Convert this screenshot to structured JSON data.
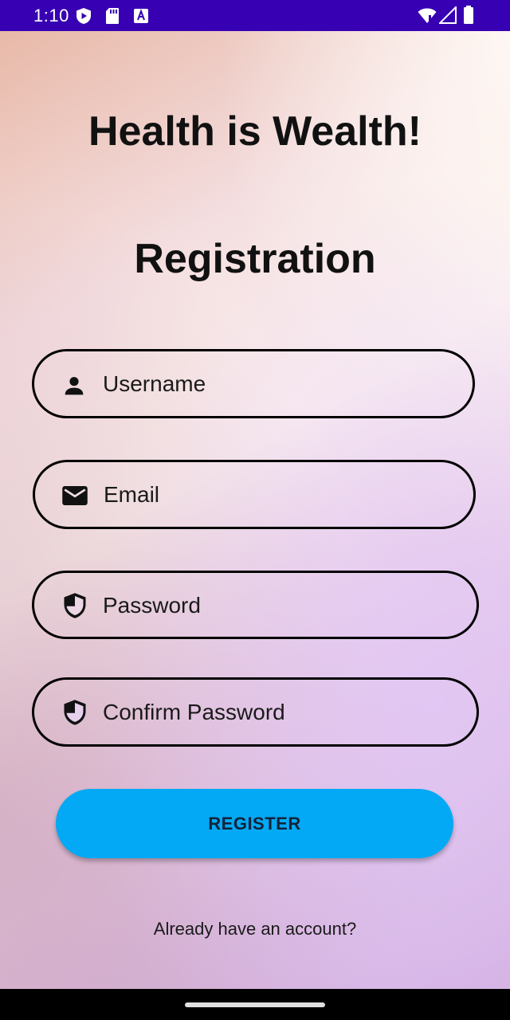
{
  "status_bar": {
    "time": "1:10"
  },
  "screen": {
    "tagline": "Health is Wealth!",
    "title": "Registration"
  },
  "form": {
    "username_placeholder": "Username",
    "email_placeholder": "Email",
    "password_placeholder": "Password",
    "confirm_password_placeholder": "Confirm Password"
  },
  "actions": {
    "register_label": "REGISTER",
    "login_link": "Already have an account?"
  },
  "colors": {
    "status_bar": "#3700b3",
    "register_button": "#03a9f4"
  },
  "icons": {
    "username": "person-icon",
    "email": "mail-icon",
    "password": "shield-icon",
    "confirm_password": "shield-icon"
  }
}
